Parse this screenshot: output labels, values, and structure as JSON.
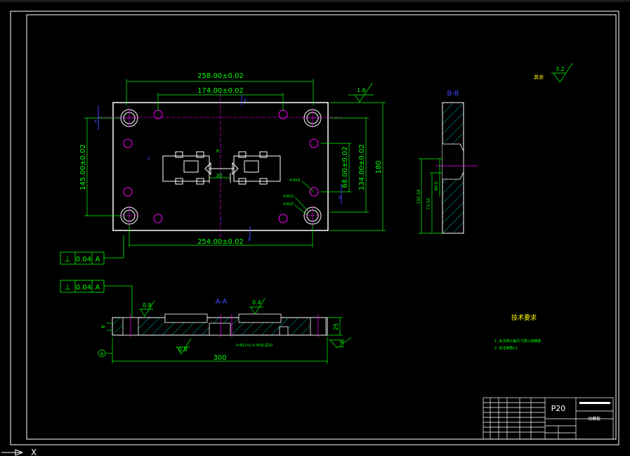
{
  "drawing": {
    "dims": {
      "top_outer": "258.00±0.02",
      "top_inner": "174.00±0.02",
      "bottom": "254.00±0.02",
      "left_height": "145.00±0.02",
      "right_inner": "68.00±0.02",
      "right_mid": "134.00±0.02",
      "right_outer": "180",
      "center_small": "30",
      "length_300": "300",
      "thick_25": "25",
      "left_6": "6"
    },
    "tolerance": {
      "symbol": "⊥",
      "value": "0.04",
      "datum": "A"
    },
    "roughness": {
      "top_right": "1.6",
      "bottom_right": "1.6",
      "sec_left": "0.8",
      "sec_mid": "0.4",
      "sec_bottom": "0.8",
      "corner_value": "3.2",
      "corner_label": "其余"
    },
    "section_labels": {
      "aa": "A-A",
      "bb": "B-B",
      "a": "A",
      "b": "B"
    },
    "bb_dims": {
      "d1": "192.54",
      "d2": "73.50",
      "d3": "40.0"
    },
    "notes": {
      "title": "技术要求",
      "items": [
        "1. 未注明公差尺寸按三级精度",
        "2. 未注倒角C1"
      ]
    },
    "title_block": {
      "part_code": "P20",
      "part_name": "动模板"
    },
    "hole_labels": [
      "4-Φ32",
      "4-Φ16",
      "4-Φ20",
      "4-Φ12×L.5-Φ18,深20"
    ]
  }
}
